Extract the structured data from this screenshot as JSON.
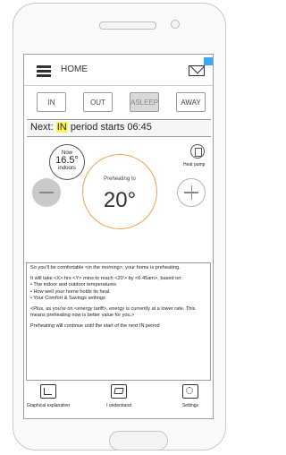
{
  "header": {
    "title": "HOME"
  },
  "modes": [
    {
      "label": "IN"
    },
    {
      "label": "OUT"
    },
    {
      "label": "ASLEEP"
    },
    {
      "label": "AWAY"
    }
  ],
  "next_period": {
    "prefix": "Next:",
    "mode": "IN",
    "suffix": "period starts 06:45"
  },
  "current": {
    "label": "Now",
    "temperature": "16.5°",
    "location": "indoors"
  },
  "heat_pump": {
    "label": "Heat pump"
  },
  "target": {
    "status": "Preheating to",
    "temperature": "20°"
  },
  "info": {
    "p1": "So you'll be comfortable <in the morning>, your home is preheating.",
    "p2": "It will take <X> hrs <Y> mins to reach <20'> by <6.45am>, based on:",
    "bullets": [
      "The indoor and outdoor temperatures",
      "How well your home holds its heat",
      "Your Comfort & Savings settings"
    ],
    "p3": "<Plus, as you're on <energy tariff>, energy is currently at a lower rate. This means preheating now is better value for you.>",
    "p4": "Preheating will continue until the start of the next IN period"
  },
  "tabs": [
    {
      "label": "Graphical explanation"
    },
    {
      "label": "I understand"
    },
    {
      "label": "Settings"
    }
  ],
  "colors": {
    "accent": "#f2a05a",
    "highlight": "#fff35c",
    "badge": "#3fa6f0"
  }
}
